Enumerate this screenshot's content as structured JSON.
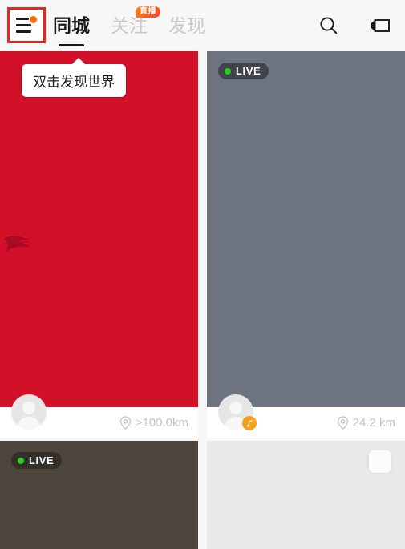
{
  "header": {
    "menu_icon": "hamburger-menu-icon-with-dot",
    "tabs": [
      {
        "label": "同城",
        "active": true,
        "badge": null
      },
      {
        "label": "关注",
        "active": false,
        "badge": "直播"
      },
      {
        "label": "发现",
        "active": false,
        "badge": null
      }
    ],
    "actions": [
      {
        "name": "search-icon",
        "label": "搜索"
      },
      {
        "name": "video-camera-icon",
        "label": "直播"
      }
    ]
  },
  "tooltip": {
    "text": "双击发现世界"
  },
  "cards": {
    "top_left": {
      "background_color": "#d3102a",
      "distance": ">100.0km",
      "live": false,
      "avatar_badge": null
    },
    "top_right": {
      "background_color": "#6d7480",
      "distance": "24.2 km",
      "live": true,
      "live_label": "LIVE",
      "avatar_badge": "music-note-icon"
    },
    "bottom_left": {
      "background_color": "#4e463c",
      "live": true,
      "live_label": "LIVE"
    },
    "bottom_right": {
      "background_color": "#e9e9e9",
      "live": false
    }
  },
  "colors": {
    "accent_red": "#e8251f",
    "badge_orange": "#ff6a00",
    "live_green": "#25d11a",
    "music_badge": "#f5a01b"
  }
}
